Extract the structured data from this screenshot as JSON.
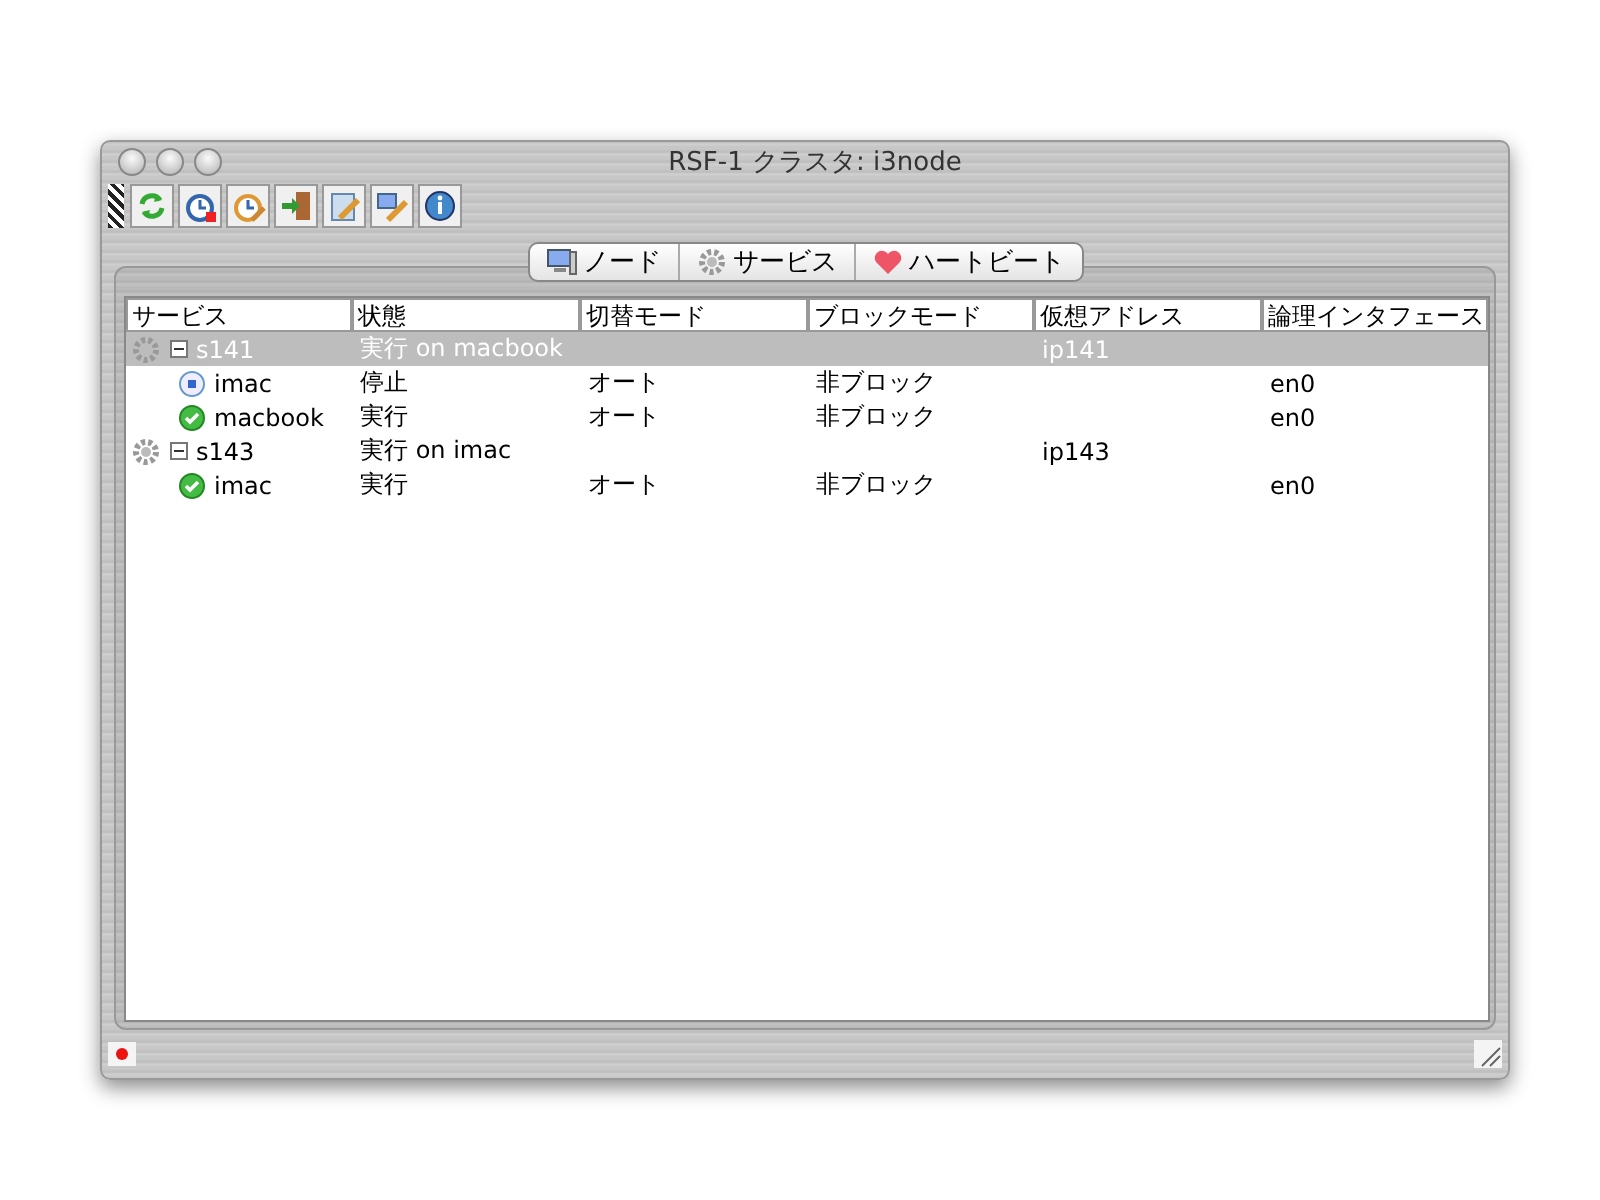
{
  "window": {
    "title": "RSF-1 クラスタ: i3node"
  },
  "toolbar": [
    {
      "kind": "refresh"
    },
    {
      "kind": "clock-stop"
    },
    {
      "kind": "clock-edit"
    },
    {
      "kind": "exit"
    },
    {
      "kind": "edit"
    },
    {
      "kind": "config"
    },
    {
      "kind": "info"
    }
  ],
  "tabs": [
    {
      "label": "ノード",
      "kind": "node",
      "selected": false
    },
    {
      "label": "サービス",
      "kind": "service",
      "selected": false
    },
    {
      "label": "ハートビート",
      "kind": "heart",
      "selected": false
    }
  ],
  "table": {
    "columns": [
      "サービス",
      "状態",
      "切替モード",
      "ブロックモード",
      "仮想アドレス",
      "論理インタフェース"
    ],
    "rows": [
      {
        "kind": "service",
        "expanded": true,
        "selected": true,
        "cells": [
          "s141",
          "実行 on macbook",
          "",
          "",
          "ip141",
          ""
        ],
        "children": [
          {
            "kind": "node",
            "running": false,
            "selected": false,
            "cells": [
              "imac",
              "停止",
              "オート",
              "非ブロック",
              "",
              "en0"
            ]
          },
          {
            "kind": "node",
            "running": true,
            "selected": false,
            "cells": [
              "macbook",
              "実行",
              "オート",
              "非ブロック",
              "",
              "en0"
            ]
          }
        ]
      },
      {
        "kind": "service",
        "expanded": true,
        "selected": false,
        "cells": [
          "s143",
          "実行 on imac",
          "",
          "",
          "ip143",
          ""
        ],
        "children": [
          {
            "kind": "node",
            "running": true,
            "selected": false,
            "cells": [
              "imac",
              "実行",
              "オート",
              "非ブロック",
              "",
              "en0"
            ]
          }
        ]
      }
    ]
  }
}
